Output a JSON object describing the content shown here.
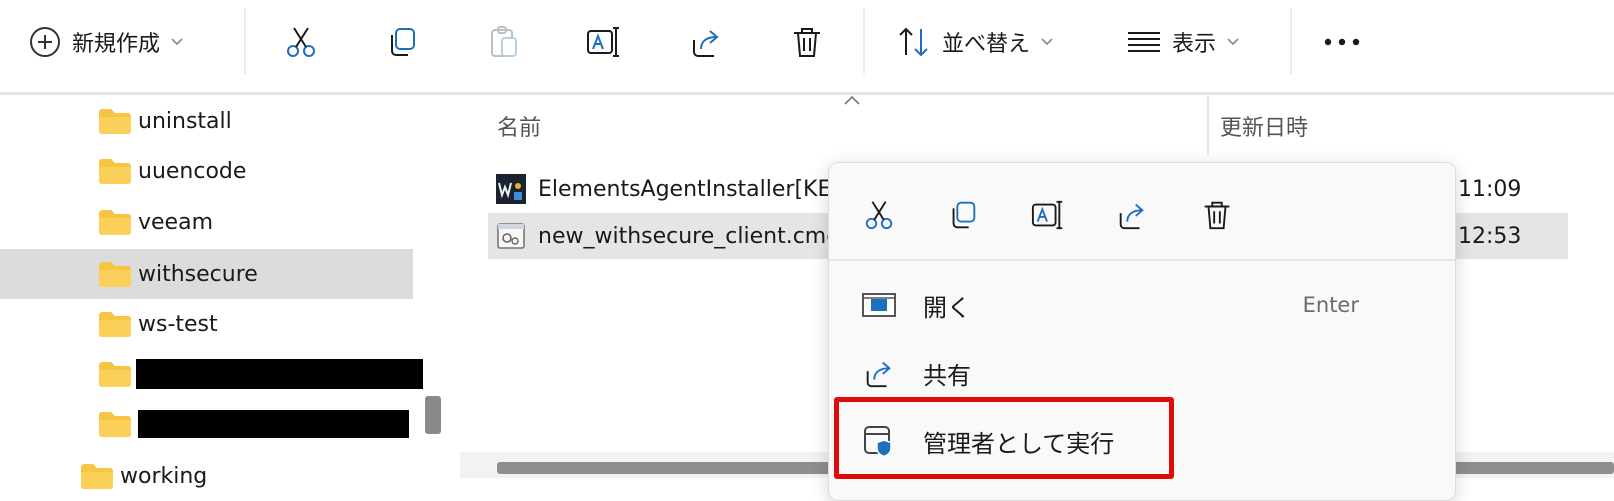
{
  "toolbar": {
    "new_label": "新規作成",
    "sort_label": "並べ替え",
    "view_label": "表示",
    "icons": [
      "plus-circle-icon",
      "cut-icon",
      "copy-icon",
      "paste-icon",
      "rename-icon",
      "share-icon",
      "delete-icon",
      "sort-icon",
      "view-icon",
      "more-icon"
    ],
    "accent_color": "#1f6fbf"
  },
  "nav": {
    "items": [
      {
        "label": "uninstall"
      },
      {
        "label": "uuencode"
      },
      {
        "label": "veeam"
      },
      {
        "label": "withsecure",
        "selected": true
      },
      {
        "label": "ws-test"
      },
      {
        "label": "",
        "redacted": true
      },
      {
        "label": "",
        "redacted": true
      },
      {
        "label": "working"
      }
    ],
    "folder_color": "#f6c543"
  },
  "file_list": {
    "columns": {
      "name": "名前",
      "modified": "更新日時"
    },
    "rows": [
      {
        "name": "ElementsAgentInstaller[KE",
        "time": "11:09"
      },
      {
        "name": "new_withsecure_client.cmc",
        "time": "12:53",
        "selected": true
      }
    ]
  },
  "context_menu": {
    "icons": [
      "cut-icon",
      "copy-icon",
      "rename-icon",
      "share-icon",
      "delete-icon"
    ],
    "items": [
      {
        "label": "開く",
        "shortcut": "Enter"
      },
      {
        "label": "共有"
      },
      {
        "label": "管理者として実行",
        "highlighted": true
      }
    ],
    "highlight_color": "#e10a0a"
  }
}
